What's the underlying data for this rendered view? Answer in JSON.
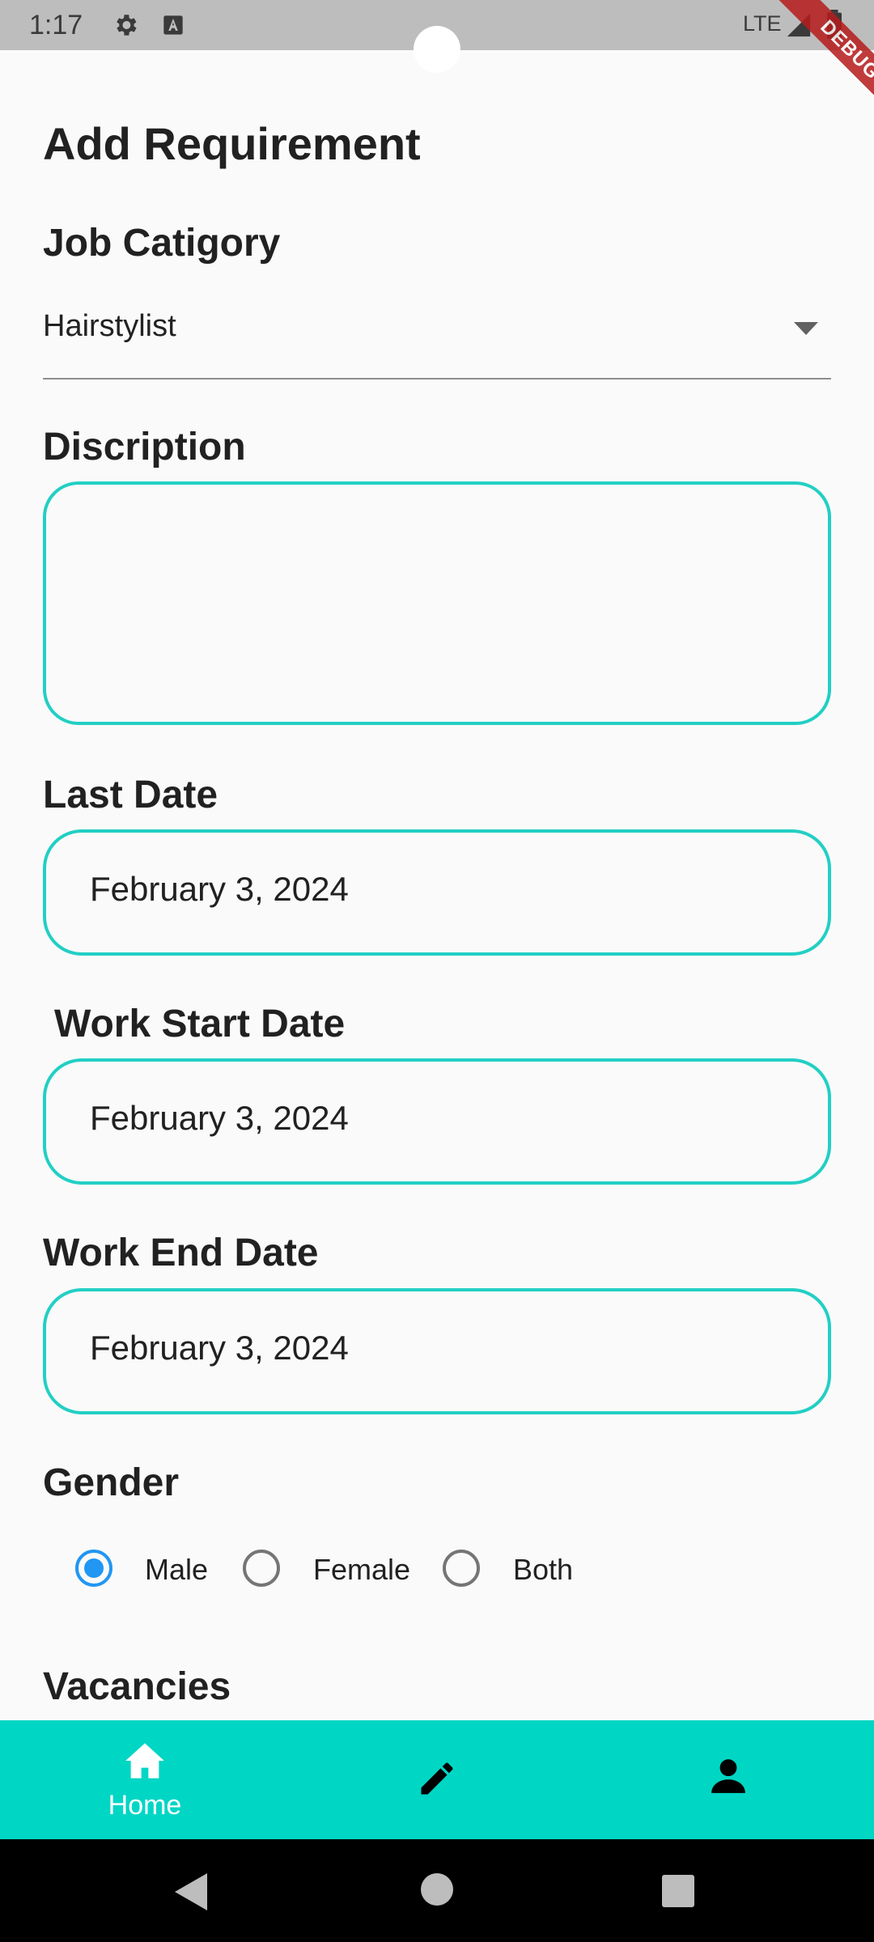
{
  "status_bar": {
    "time": "1:17",
    "network": "LTE",
    "icons": [
      "gear-icon",
      "a-badge-icon",
      "signal-icon",
      "battery-icon"
    ]
  },
  "debug_banner": "DEBUG",
  "page": {
    "title": "Add Requirement"
  },
  "job_category": {
    "label": "Job Catigory",
    "selected": "Hairstylist"
  },
  "description": {
    "label": "Discription",
    "value": ""
  },
  "last_date": {
    "label": "Last Date",
    "value": "February 3, 2024"
  },
  "work_start_date": {
    "label": "Work Start Date",
    "value": "February 3, 2024"
  },
  "work_end_date": {
    "label": "Work End Date",
    "value": "February 3, 2024"
  },
  "gender": {
    "label": "Gender",
    "options": [
      "Male",
      "Female",
      "Both"
    ],
    "selected": "Male"
  },
  "vacancies": {
    "label": "Vacancies"
  },
  "bottom_nav": {
    "items": [
      {
        "label": "Home",
        "icon": "home-icon",
        "active": true
      },
      {
        "label": "",
        "icon": "edit-icon",
        "active": false
      },
      {
        "label": "",
        "icon": "person-icon",
        "active": false
      }
    ]
  },
  "colors": {
    "accent": "#22cfc4",
    "nav_background": "#00d6c4",
    "radio_selected": "#2196f3",
    "status_bar": "#bdbdbd",
    "debug": "#b71c1c"
  }
}
